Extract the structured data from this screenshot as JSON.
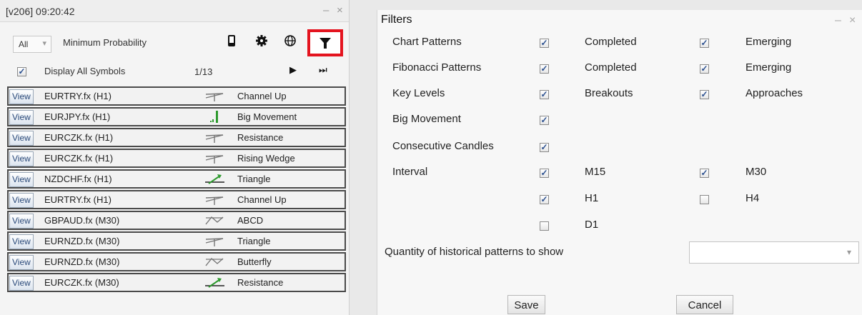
{
  "left_panel": {
    "title": "[v206] 09:20:42",
    "min_btn": "–",
    "close_btn": "×",
    "combo_value": "All",
    "combo_arrow": "▾",
    "min_probability": "Minimum Probability",
    "display_all_label": "Display All Symbols",
    "display_all_checked": "✓",
    "page_count": "1/13",
    "play": "▶",
    "skip": "⏭",
    "view_label": "View",
    "rows": [
      {
        "symbol": "EURTRY.fx (H1)",
        "pattern": "Channel Up",
        "icon": "channel-icon"
      },
      {
        "symbol": "EURJPY.fx (H1)",
        "pattern": "Big Movement",
        "icon": "big-movement-icon"
      },
      {
        "symbol": "EURCZK.fx (H1)",
        "pattern": "Resistance",
        "icon": "channel-icon"
      },
      {
        "symbol": "EURCZK.fx (H1)",
        "pattern": "Rising Wedge",
        "icon": "channel-icon"
      },
      {
        "symbol": "NZDCHF.fx (H1)",
        "pattern": "Triangle",
        "icon": "triangle-green-icon"
      },
      {
        "symbol": "EURTRY.fx (H1)",
        "pattern": "Channel Up",
        "icon": "channel-icon"
      },
      {
        "symbol": "GBPAUD.fx (M30)",
        "pattern": "ABCD",
        "icon": "abcd-icon"
      },
      {
        "symbol": "EURNZD.fx (M30)",
        "pattern": "Triangle",
        "icon": "channel-icon"
      },
      {
        "symbol": "EURNZD.fx (M30)",
        "pattern": "Butterfly",
        "icon": "abcd-icon"
      },
      {
        "symbol": "EURCZK.fx (M30)",
        "pattern": "Resistance",
        "icon": "triangle-green-icon"
      }
    ]
  },
  "filters": {
    "title": "Filters",
    "min_btn": "–",
    "close_btn": "×",
    "check_mark": "✓",
    "chart_patterns": "Chart Patterns",
    "fibonacci_patterns": "Fibonacci Patterns",
    "key_levels": "Key Levels",
    "big_movement": "Big Movement",
    "consecutive_candles": "Consecutive Candles",
    "interval": "Interval",
    "completed": "Completed",
    "emerging": "Emerging",
    "breakouts": "Breakouts",
    "approaches": "Approaches",
    "m15": "M15",
    "m30": "M30",
    "h1": "H1",
    "h4": "H4",
    "d1": "D1",
    "historical_label": "Quantity of historical patterns to show",
    "historical_value": "",
    "dropdown_arrow": "▾",
    "save": "Save",
    "cancel": "Cancel"
  },
  "colors": {
    "highlight": "#e4141f",
    "pattern_green": "#2e9a2e",
    "row_border": "#4a4a4a"
  }
}
